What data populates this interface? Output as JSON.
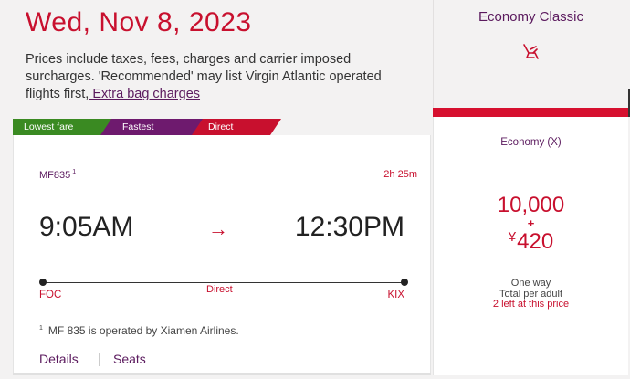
{
  "header": {
    "date": "Wed, Nov 8, 2023",
    "notice_text": "Prices include taxes, fees, charges and carrier imposed surcharges. 'Recommended' may list Virgin Atlantic operated flights first,",
    "extra_bag_link": " Extra bag charges"
  },
  "cabin": {
    "name": "Economy Classic",
    "icon": "seat-recline-icon",
    "accent_color": "#d6102f"
  },
  "tags": [
    {
      "label": "Lowest fare",
      "color": "#3a8a22"
    },
    {
      "label": "Fastest",
      "color": "#6e1a6e"
    },
    {
      "label": "Direct",
      "color": "#c8102e"
    }
  ],
  "flight": {
    "number": "MF835",
    "footnote_ref": "1",
    "duration": "2h 25m",
    "departure_time": "9:05AM",
    "arrival_time": "12:30PM",
    "arrow": "→",
    "origin": "FOC",
    "destination": "KIX",
    "stops": "Direct",
    "footnote_number": "1",
    "footnote_text": "MF 835 is operated by Xiamen Airlines."
  },
  "card_tabs": {
    "details": "Details",
    "seats": "Seats"
  },
  "fare": {
    "class_label": "Economy (X)",
    "miles": "10,000",
    "plus": "+",
    "currency": "¥",
    "tax": "420",
    "trip_type": "One way",
    "total_label": "Total per adult",
    "availability": "2 left at this price"
  }
}
